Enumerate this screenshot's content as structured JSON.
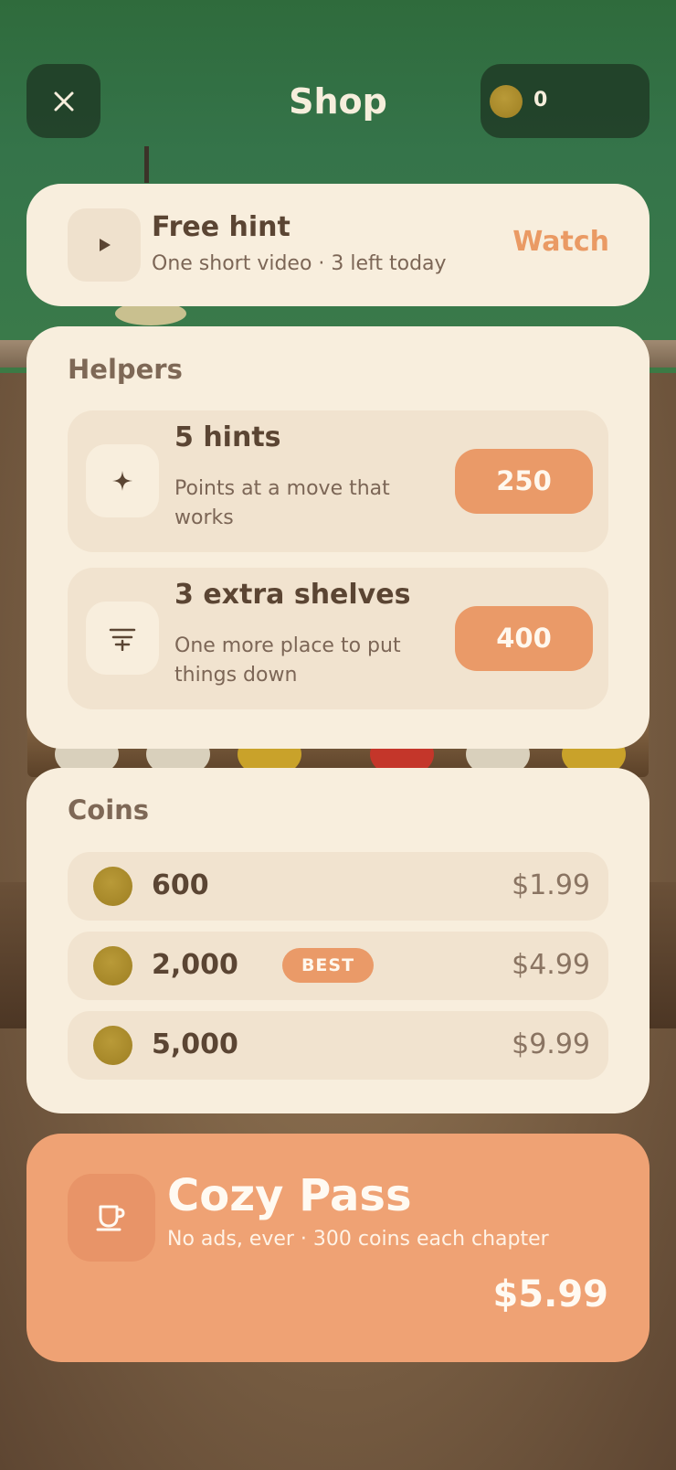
{
  "header": {
    "title": "Shop",
    "coin_balance": "0"
  },
  "free_hint": {
    "title": "Free hint",
    "subtitle": "One short video · 3 left today",
    "action_label": "Watch"
  },
  "helpers": {
    "section_title": "Helpers",
    "items": [
      {
        "title": "5 hints",
        "description": "Points at a move that works",
        "price": "250",
        "icon": "sparkle-icon"
      },
      {
        "title": "3 extra shelves",
        "description": "One more place to put things down",
        "price": "400",
        "icon": "shelf-icon"
      }
    ]
  },
  "coins": {
    "section_title": "Coins",
    "packs": [
      {
        "amount": "600",
        "price": "$1.99",
        "badge": ""
      },
      {
        "amount": "2,000",
        "price": "$4.99",
        "badge": "BEST"
      },
      {
        "amount": "5,000",
        "price": "$9.99",
        "badge": ""
      }
    ]
  },
  "pass": {
    "title": "Cozy Pass",
    "subtitle": "No ads, ever · 300 coins each chapter",
    "price": "$5.99",
    "icon": "cup-icon"
  },
  "colors": {
    "accent": "#ea9a68",
    "card": "#f8eedd",
    "pass": "#efa274",
    "coin": "#a8892c"
  }
}
